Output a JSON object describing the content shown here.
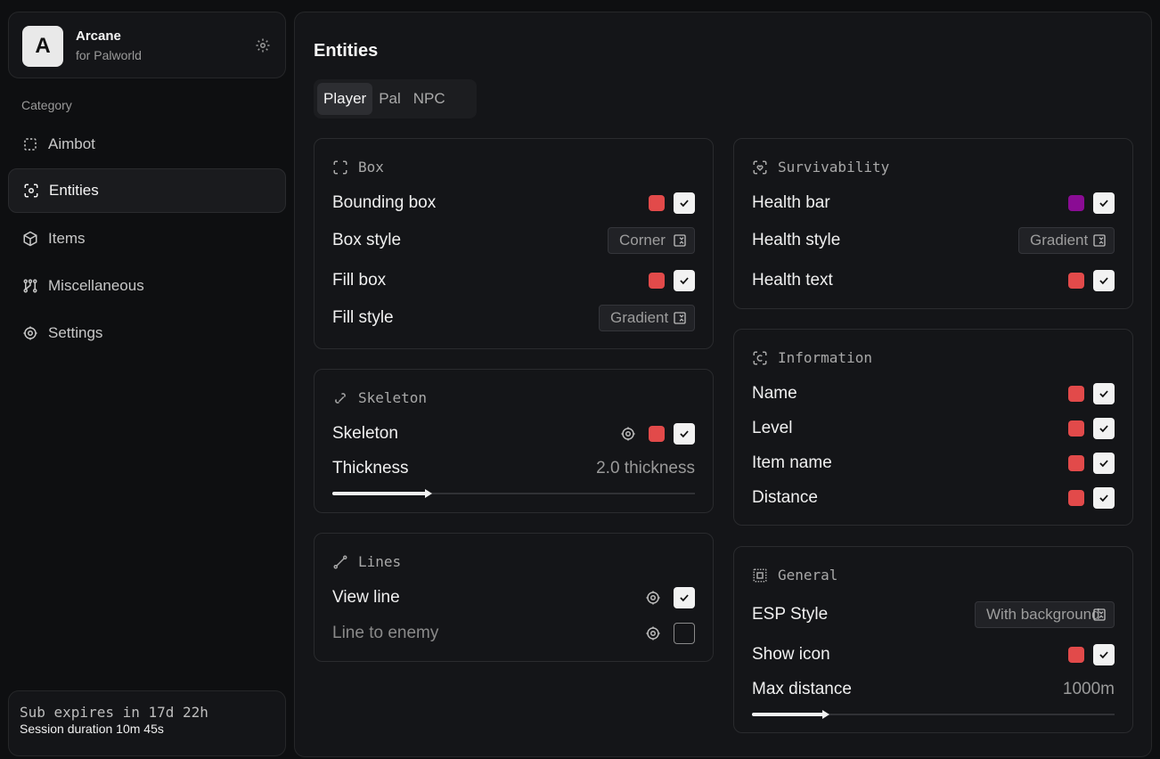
{
  "app": {
    "name": "Arcane",
    "subtitle": "for Palworld",
    "logo_letter": "A"
  },
  "sidebar": {
    "category_label": "Category",
    "items": [
      {
        "label": "Aimbot",
        "icon": "aimbot-dashed-square-icon"
      },
      {
        "label": "Entities",
        "icon": "entities-scan-icon",
        "active": true
      },
      {
        "label": "Items",
        "icon": "box-cube-icon"
      },
      {
        "label": "Miscellaneous",
        "icon": "nodes-icon"
      },
      {
        "label": "Settings",
        "icon": "gear-icon"
      }
    ]
  },
  "status": {
    "subscription": "Sub expires in 17d 22h",
    "session": "Session duration 10m 45s"
  },
  "main": {
    "title": "Entities",
    "tabs": [
      {
        "label": "Player",
        "active": true
      },
      {
        "label": "Pal"
      },
      {
        "label": "NPC"
      }
    ]
  },
  "colors": {
    "red": "#e24a4a",
    "purple": "#8a0c94",
    "check_bg": "#f2f2f2"
  },
  "box": {
    "title": "Box",
    "bounding_box": {
      "label": "Bounding box",
      "color": "#e24a4a",
      "checked": true
    },
    "box_style": {
      "label": "Box style",
      "value": "Corner"
    },
    "fill_box": {
      "label": "Fill box",
      "color": "#e24a4a",
      "checked": true
    },
    "fill_style": {
      "label": "Fill style",
      "value": "Gradient"
    }
  },
  "skeleton": {
    "title": "Skeleton",
    "skeleton": {
      "label": "Skeleton",
      "color": "#e24a4a",
      "checked": true
    },
    "thickness": {
      "label": "Thickness",
      "value_text": "2.0 thickness",
      "fraction": 0.26
    }
  },
  "lines": {
    "title": "Lines",
    "view_line": {
      "label": "View line",
      "checked": true
    },
    "line_to_enemy": {
      "label": "Line to enemy",
      "checked": false
    }
  },
  "survivability": {
    "title": "Survivability",
    "health_bar": {
      "label": "Health bar",
      "color": "#8a0c94",
      "checked": true
    },
    "health_style": {
      "label": "Health style",
      "value": "Gradient"
    },
    "health_text": {
      "label": "Health text",
      "color": "#e24a4a",
      "checked": true
    }
  },
  "information": {
    "title": "Information",
    "name": {
      "label": "Name",
      "color": "#e24a4a",
      "checked": true
    },
    "level": {
      "label": "Level",
      "color": "#e24a4a",
      "checked": true
    },
    "item_name": {
      "label": "Item name",
      "color": "#e24a4a",
      "checked": true
    },
    "distance": {
      "label": "Distance",
      "color": "#e24a4a",
      "checked": true
    }
  },
  "general": {
    "title": "General",
    "esp_style": {
      "label": "ESP Style",
      "value": "With background"
    },
    "show_icon": {
      "label": "Show icon",
      "color": "#e24a4a",
      "checked": true
    },
    "max_distance": {
      "label": "Max distance",
      "value_text": "1000m",
      "fraction": 0.2
    }
  }
}
